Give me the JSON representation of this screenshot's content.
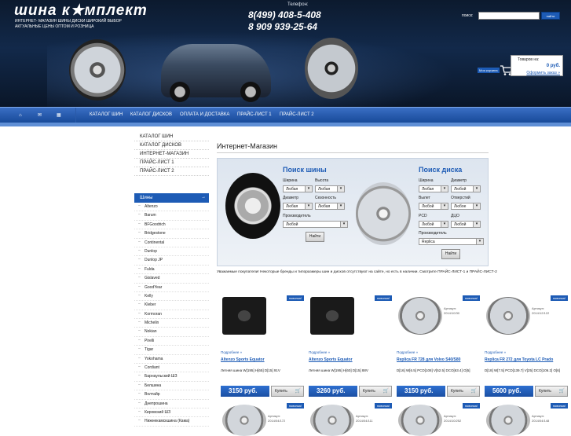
{
  "header": {
    "logo": "шина к★мплект",
    "tagline1": "ИНТЕРНЕТ- МАГАЗИН ШИНЫ ДИСКИ ШИРОКИЙ ВЫБОР",
    "tagline2": "АКТУАЛЬНЫЕ ЦЕНЫ ОПТОМ И РОЗНИЦА",
    "phone_label": "Телефон:",
    "phone1": "8(499) 408-5-408",
    "phone2": "8 909 939-25-64",
    "search_label": "поиск:",
    "search_value": "",
    "search_button": "найти",
    "cart_items": "Товаров на:",
    "cart_total": "0 руб.",
    "cart_checkout": "Оформить заказ »",
    "my_cart": "Моя корзина"
  },
  "nav": {
    "items": [
      "КАТАЛОГ ШИН",
      "КАТАЛОГ ДИСКОВ",
      "ОПЛАТА И ДОСТАВКА",
      "ПРАЙС-ЛИСТ 1",
      "ПРАЙС-ЛИСТ 2"
    ]
  },
  "left_menu": [
    "КАТАЛОГ ШИН",
    "КАТАЛОГ ДИСКОВ",
    "ИНТЕРНЕТ-МАГАЗИН",
    "ПРАЙС-ЛИСТ 1",
    "ПРАЙС-ЛИСТ 2"
  ],
  "brands": {
    "heading": "Шины",
    "items": [
      "Altenzo",
      "Barum",
      "BFGoodrich",
      "Bridgestone",
      "Continental",
      "Dunlop",
      "Dunlop JP",
      "Fulda",
      "Gislaved",
      "GoodYear",
      "Kelly",
      "Kleber",
      "Kormoran",
      "Michelin",
      "Nokian",
      "Pirelli",
      "Tigar",
      "Yokohama",
      "Cordiant",
      "Барнаульский ШЗ",
      "Белшина",
      "Волтайр",
      "Днепрошина",
      "Кировский ШЗ",
      "Нижнекамскшина (Кама)"
    ]
  },
  "page": {
    "title": "Интернет-Магазин"
  },
  "tire_search": {
    "title": "Поиск шины",
    "width_label": "Ширина",
    "width_value": "Любая",
    "height_label": "Высота",
    "height_value": "Любая",
    "diameter_label": "Диаметр",
    "diameter_value": "Любая",
    "season_label": "Сезонность",
    "season_value": "Любая",
    "maker_label": "Производитель",
    "maker_value": "Любой",
    "button": "Найти"
  },
  "disk_search": {
    "title": "Поиск диска",
    "width_label": "Ширина",
    "width_value": "Любая",
    "diameter_label": "Диаметр",
    "diameter_value": "Любой",
    "offset_label": "Вылет",
    "offset_value": "Любой",
    "holes_label": "Отверстий",
    "holes_value": "Любое",
    "pcd_label": "PCD",
    "pcd_value": "Любой",
    "dco_label": "ДЦО",
    "dco_value": "Любой",
    "maker_label": "Производитель",
    "maker_value": "Replica",
    "button": "Найти"
  },
  "notice": "Уважаемые покупатели! Некоторые бренды и типоразмеры шин и дисков отсутствуют на сайте, но есть в наличии. Смотрите ПРАЙС-ЛИСТ-1 и ПРАЙС-ЛИСТ-2",
  "products": [
    {
      "badge": "новинка!",
      "more": "Подробнее »",
      "name": "Altenzo Sports Equator",
      "desc": "Летняя шина W[195] H[65] D[15] 91V",
      "price": "3150 руб.",
      "buy": "Купить",
      "art": "",
      "date": "",
      "kind": "tire"
    },
    {
      "badge": "новинка!",
      "more": "Подробнее »",
      "name": "Altenzo Sports Equator",
      "desc": "Летняя шина W[195] H[60] D[15] 88V",
      "price": "3260 руб.",
      "buy": "Купить",
      "art": "",
      "date": "",
      "kind": "tire"
    },
    {
      "badge": "новинка!",
      "more": "Подробнее »",
      "name": "Replica FR 728 для Volvo S40/S80",
      "desc": "D[16] W[6.5] PCD[108] V[52.5] DCO[63.4] O[5]",
      "price": "3150 руб.",
      "buy": "Купить",
      "art": "Артикул:",
      "date": "2014/10/30",
      "kind": "rim"
    },
    {
      "badge": "новинка!",
      "more": "Подробнее »",
      "name": "Replica FR 272 для Toyota LC Prado",
      "desc": "D[18] W[7.5] PCD[139.7] V[25] DCO[106.2] O[6]",
      "price": "5600 руб.",
      "buy": "Купить",
      "art": "Артикул:",
      "date": "2014/12/122",
      "kind": "rim"
    }
  ],
  "products_row2": [
    {
      "badge": "новинка!",
      "art": "Артикул:",
      "date": "2014/04/172"
    },
    {
      "badge": "новинка!",
      "art": "Артикул:",
      "date": "2014/04/111"
    },
    {
      "badge": "новинка!",
      "art": "Артикул:",
      "date": "2014/10/252"
    },
    {
      "badge": "новинка!",
      "art": "Артикул:",
      "date": "2014/04/148"
    }
  ]
}
